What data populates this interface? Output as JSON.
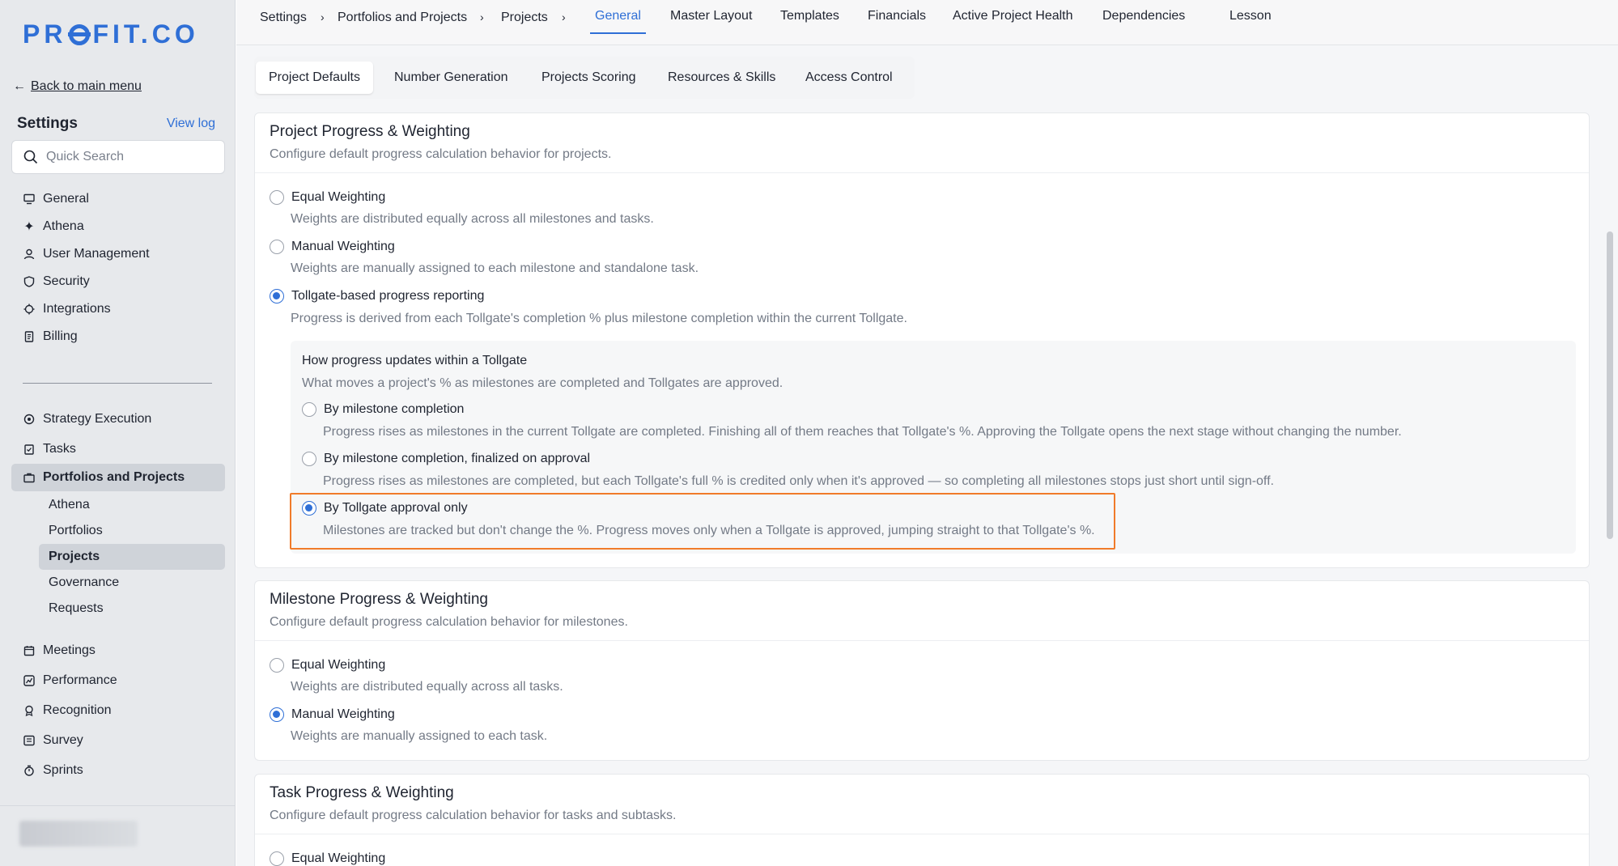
{
  "sidebar": {
    "logo": "PROFIT.CO",
    "back_link": "Back to main menu",
    "settings_title": "Settings",
    "view_log": "View log",
    "search_placeholder": "Quick Search",
    "nav_top": [
      {
        "label": "General",
        "icon": "monitor-icon"
      },
      {
        "label": "Athena",
        "icon": "sparkle-icon"
      },
      {
        "label": "User Management",
        "icon": "user-icon"
      },
      {
        "label": "Security",
        "icon": "shield-icon"
      },
      {
        "label": "Integrations",
        "icon": "plug-icon"
      },
      {
        "label": "Billing",
        "icon": "receipt-icon"
      }
    ],
    "nav_bottom": [
      {
        "label": "Strategy Execution",
        "icon": "target-icon"
      },
      {
        "label": "Tasks",
        "icon": "clipboard-icon"
      },
      {
        "label": "Portfolios and Projects",
        "icon": "briefcase-icon",
        "active": true
      }
    ],
    "sub_items": [
      "Athena",
      "Portfolios",
      "Projects",
      "Governance",
      "Requests"
    ],
    "active_sub": "Projects",
    "nav_more": [
      {
        "label": "Meetings",
        "icon": "calendar-icon"
      },
      {
        "label": "Performance",
        "icon": "chart-icon"
      },
      {
        "label": "Recognition",
        "icon": "award-icon"
      },
      {
        "label": "Survey",
        "icon": "list-icon"
      },
      {
        "label": "Sprints",
        "icon": "timer-icon"
      }
    ]
  },
  "topbar": {
    "breadcrumbs": [
      "Settings",
      "Portfolios and Projects",
      "Projects"
    ],
    "tabs": [
      "General",
      "Master Layout",
      "Templates",
      "Financials",
      "Active Project Health",
      "Dependencies",
      "Lesson"
    ],
    "active_tab": "General"
  },
  "subtabs": {
    "items": [
      "Project Defaults",
      "Number Generation",
      "Projects Scoring",
      "Resources & Skills",
      "Access Control"
    ],
    "active": "Project Defaults"
  },
  "project_progress": {
    "title": "Project Progress & Weighting",
    "desc": "Configure default progress calculation behavior for projects.",
    "options": [
      {
        "label": "Equal Weighting",
        "desc": "Weights are distributed equally across all milestones and tasks.",
        "checked": false
      },
      {
        "label": "Manual Weighting",
        "desc": "Weights are manually assigned to each milestone and standalone task.",
        "checked": false
      },
      {
        "label": "Tollgate-based progress reporting",
        "desc": "Progress is derived from each Tollgate's completion % plus milestone completion within the current Tollgate.",
        "checked": true
      }
    ],
    "tollgate": {
      "title": "How progress updates within a Tollgate",
      "desc": "What moves a project's % as milestones are completed and Tollgates are approved.",
      "options": [
        {
          "label": "By milestone completion",
          "desc": "Progress rises as milestones in the current Tollgate are completed. Finishing all of them reaches that Tollgate's %. Approving the Tollgate opens the next stage without changing the number.",
          "checked": false
        },
        {
          "label": "By milestone completion, finalized on approval",
          "desc": "Progress rises as milestones are completed, but each Tollgate's full % is credited only when it's approved — so completing all milestones stops just short until sign-off.",
          "checked": false
        },
        {
          "label": "By Tollgate approval only",
          "desc": "Milestones are tracked but don't change the %. Progress moves only when a Tollgate is approved, jumping straight to that Tollgate's %.",
          "checked": true
        }
      ]
    }
  },
  "milestone_progress": {
    "title": "Milestone Progress & Weighting",
    "desc": "Configure default progress calculation behavior for milestones.",
    "options": [
      {
        "label": "Equal Weighting",
        "desc": "Weights are distributed equally across all tasks.",
        "checked": false
      },
      {
        "label": "Manual Weighting",
        "desc": "Weights are manually assigned to each task.",
        "checked": true
      }
    ]
  },
  "task_progress": {
    "title": "Task Progress & Weighting",
    "desc": "Configure default progress calculation behavior for tasks and subtasks.",
    "options": [
      {
        "label": "Equal Weighting",
        "checked": false
      }
    ]
  },
  "colors": {
    "accent": "#2f6fd6",
    "highlight": "#f07b2a"
  }
}
